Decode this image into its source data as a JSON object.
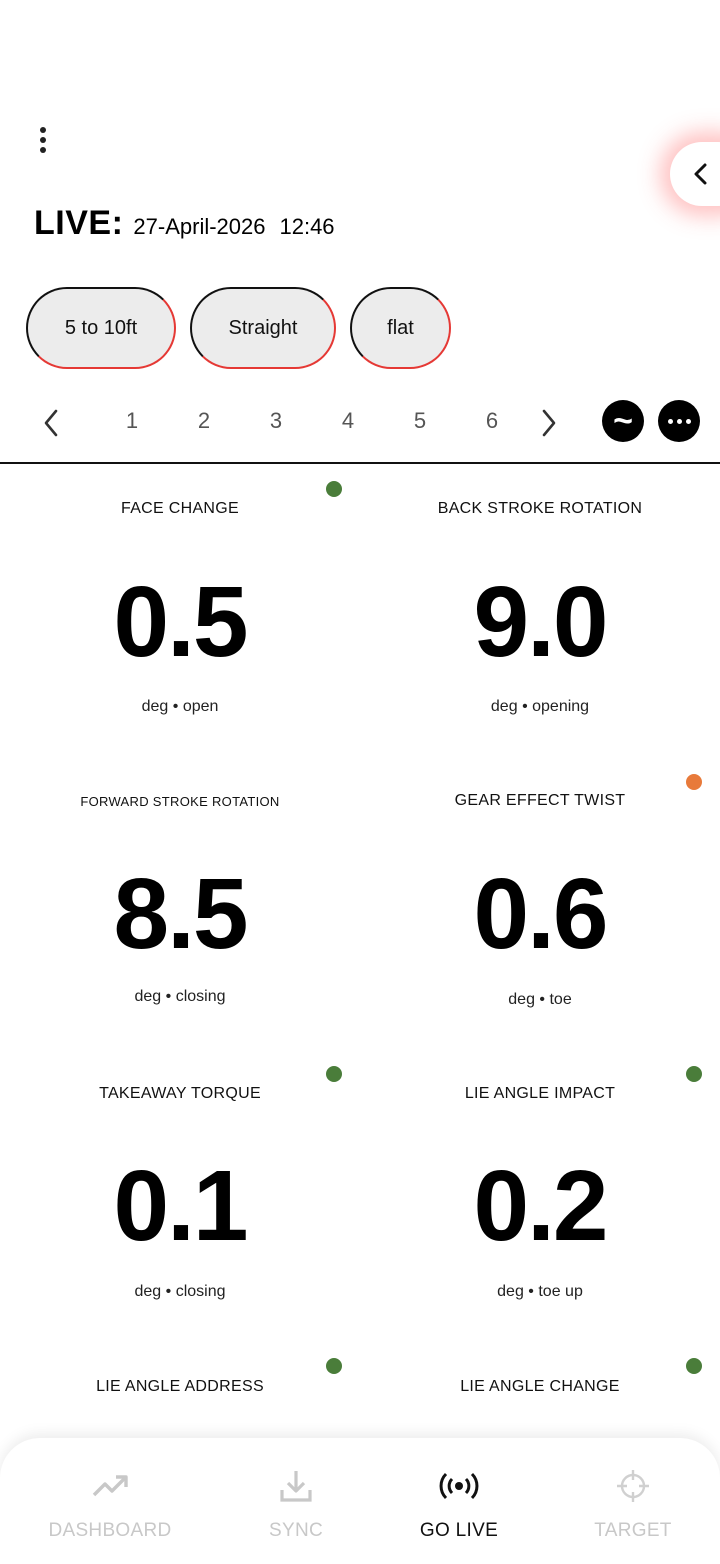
{
  "header": {
    "menu_icon": "more-vertical-icon",
    "side_tab_icon": "chevron-left-icon",
    "live_label": "LIVE:",
    "date": "27-April-2026",
    "time": "12:46"
  },
  "filters": [
    "5 to 10ft",
    "Straight",
    "flat"
  ],
  "pager": {
    "pages": [
      "1",
      "2",
      "3",
      "4",
      "5",
      "6"
    ],
    "wave_symbol": "~",
    "more_icon": "more-horizontal-icon"
  },
  "metrics": [
    {
      "title": "FACE CHANGE",
      "value": "0.5",
      "unit": "deg",
      "direction": "open",
      "status": "green"
    },
    {
      "title": "BACK STROKE ROTATION",
      "value": "9.0",
      "unit": "deg",
      "direction": "opening",
      "status": "none"
    },
    {
      "title": "FORWARD STROKE ROTATION",
      "value": "8.5",
      "unit": "deg",
      "direction": "closing",
      "status": "none"
    },
    {
      "title": "GEAR EFFECT TWIST",
      "value": "0.6",
      "unit": "deg",
      "direction": "toe",
      "status": "orange"
    },
    {
      "title": "TAKEAWAY TORQUE",
      "value": "0.1",
      "unit": "deg",
      "direction": "closing",
      "status": "green"
    },
    {
      "title": "LIE ANGLE IMPACT",
      "value": "0.2",
      "unit": "deg",
      "direction": "toe up",
      "status": "green"
    },
    {
      "title": "LIE ANGLE ADDRESS",
      "value": "",
      "unit": "",
      "direction": "",
      "status": "green"
    },
    {
      "title": "LIE ANGLE CHANGE",
      "value": "",
      "unit": "",
      "direction": "",
      "status": "green"
    }
  ],
  "unit_separator": "•",
  "colors": {
    "green": "#4a7d3a",
    "orange": "#e87a3a",
    "accent_red": "#e53935"
  },
  "nav": [
    {
      "label": "DASHBOARD",
      "icon": "trending-up-icon",
      "active": false
    },
    {
      "label": "SYNC",
      "icon": "download-icon",
      "active": false
    },
    {
      "label": "GO LIVE",
      "icon": "broadcast-icon",
      "active": true
    },
    {
      "label": "TARGET",
      "icon": "crosshair-icon",
      "active": false
    }
  ]
}
